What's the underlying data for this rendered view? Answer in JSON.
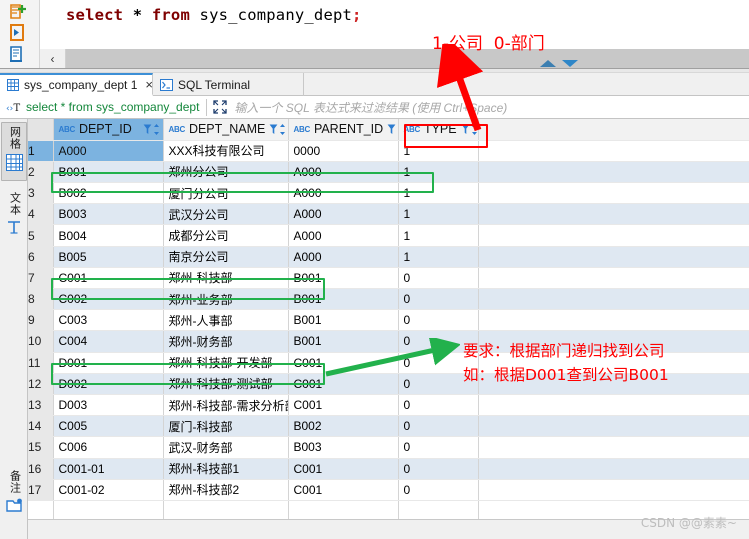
{
  "editor": {
    "sql_keyword_1": "select",
    "sql_star": "*",
    "sql_keyword_2": "from",
    "sql_table": "sys_company_dept",
    "sql_semicolon": ";",
    "scroll_left_glyph": "‹"
  },
  "toolbar": {
    "new_script_icon": "new-script-icon",
    "execute_icon": "execute-script-icon",
    "script_icon": "sql-script-icon"
  },
  "tabs": [
    {
      "label": "sys_company_dept 1",
      "icon": "grid-table-icon",
      "close": "×",
      "active": true
    },
    {
      "label": "SQL Terminal",
      "icon": "terminal-icon",
      "close": "",
      "active": false
    }
  ],
  "filter_bar": {
    "icon": "filter-text-icon",
    "sql_text": "select * from sys_company_dept",
    "expand_icon": "expand-icon",
    "placeholder": "输入一个 SQL 表达式来过滤结果 (使用 Ctrl+Space)"
  },
  "side_rail": {
    "tabs": [
      {
        "label": "网格",
        "icon": "grid-icon",
        "selected": true
      },
      {
        "label": "文本",
        "icon": "text-icon",
        "selected": false
      },
      {
        "label": "备注",
        "icon": "notes-icon",
        "selected": false
      }
    ]
  },
  "grid": {
    "row_number_header": "",
    "columns": [
      {
        "key": "DEPT_ID",
        "label": "DEPT_ID",
        "type_badge": "ABC",
        "selected": true,
        "annotated": false
      },
      {
        "key": "DEPT_NAME",
        "label": "DEPT_NAME",
        "type_badge": "ABC",
        "selected": false,
        "annotated": false
      },
      {
        "key": "PARENT_ID",
        "label": "PARENT_ID",
        "type_badge": "ABC",
        "selected": false,
        "annotated": false
      },
      {
        "key": "TYPE",
        "label": "TYPE",
        "type_badge": "ABC",
        "selected": false,
        "annotated": true
      }
    ],
    "rows": [
      {
        "n": "1",
        "DEPT_ID": "A000",
        "DEPT_NAME": "XXX科技有限公司",
        "PARENT_ID": "0000",
        "TYPE": "1"
      },
      {
        "n": "2",
        "DEPT_ID": "B001",
        "DEPT_NAME": "郑州分公司",
        "PARENT_ID": "A000",
        "TYPE": "1"
      },
      {
        "n": "3",
        "DEPT_ID": "B002",
        "DEPT_NAME": "厦门分公司",
        "PARENT_ID": "A000",
        "TYPE": "1"
      },
      {
        "n": "4",
        "DEPT_ID": "B003",
        "DEPT_NAME": "武汉分公司",
        "PARENT_ID": "A000",
        "TYPE": "1"
      },
      {
        "n": "5",
        "DEPT_ID": "B004",
        "DEPT_NAME": "成都分公司",
        "PARENT_ID": "A000",
        "TYPE": "1"
      },
      {
        "n": "6",
        "DEPT_ID": "B005",
        "DEPT_NAME": "南京分公司",
        "PARENT_ID": "A000",
        "TYPE": "1"
      },
      {
        "n": "7",
        "DEPT_ID": "C001",
        "DEPT_NAME": "郑州-科技部",
        "PARENT_ID": "B001",
        "TYPE": "0"
      },
      {
        "n": "8",
        "DEPT_ID": "C002",
        "DEPT_NAME": "郑州-业务部",
        "PARENT_ID": "B001",
        "TYPE": "0"
      },
      {
        "n": "9",
        "DEPT_ID": "C003",
        "DEPT_NAME": "郑州-人事部",
        "PARENT_ID": "B001",
        "TYPE": "0"
      },
      {
        "n": "10",
        "DEPT_ID": "C004",
        "DEPT_NAME": "郑州-财务部",
        "PARENT_ID": "B001",
        "TYPE": "0"
      },
      {
        "n": "11",
        "DEPT_ID": "D001",
        "DEPT_NAME": "郑州-科技部-开发部",
        "PARENT_ID": "C001",
        "TYPE": "0"
      },
      {
        "n": "12",
        "DEPT_ID": "D002",
        "DEPT_NAME": "郑州-科技部-测试部",
        "PARENT_ID": "C001",
        "TYPE": "0"
      },
      {
        "n": "13",
        "DEPT_ID": "D003",
        "DEPT_NAME": "郑州-科技部-需求分析部",
        "PARENT_ID": "C001",
        "TYPE": "0"
      },
      {
        "n": "14",
        "DEPT_ID": "C005",
        "DEPT_NAME": "厦门-科技部",
        "PARENT_ID": "B002",
        "TYPE": "0"
      },
      {
        "n": "15",
        "DEPT_ID": "C006",
        "DEPT_NAME": "武汉-财务部",
        "PARENT_ID": "B003",
        "TYPE": "0"
      },
      {
        "n": "16",
        "DEPT_ID": "C001-01",
        "DEPT_NAME": "郑州-科技部1",
        "PARENT_ID": "C001",
        "TYPE": "0"
      },
      {
        "n": "17",
        "DEPT_ID": "C001-02",
        "DEPT_NAME": "郑州-科技部2",
        "PARENT_ID": "C001",
        "TYPE": "0"
      }
    ],
    "selected_cell": {
      "row": "1",
      "column": "DEPT_ID"
    }
  },
  "annotations": {
    "top_label": "1-公司  0-部门",
    "requirement_line_1": "要求：根据部门递归找到公司",
    "requirement_line_2": "如：根据D001查到公司B001",
    "colors": {
      "red": "#ff0000",
      "green": "#22b14c"
    },
    "highlighted_rows": [
      "2",
      "7",
      "11"
    ],
    "highlighted_column_header": "TYPE"
  },
  "watermark": {
    "text": "CSDN @@素素~"
  }
}
